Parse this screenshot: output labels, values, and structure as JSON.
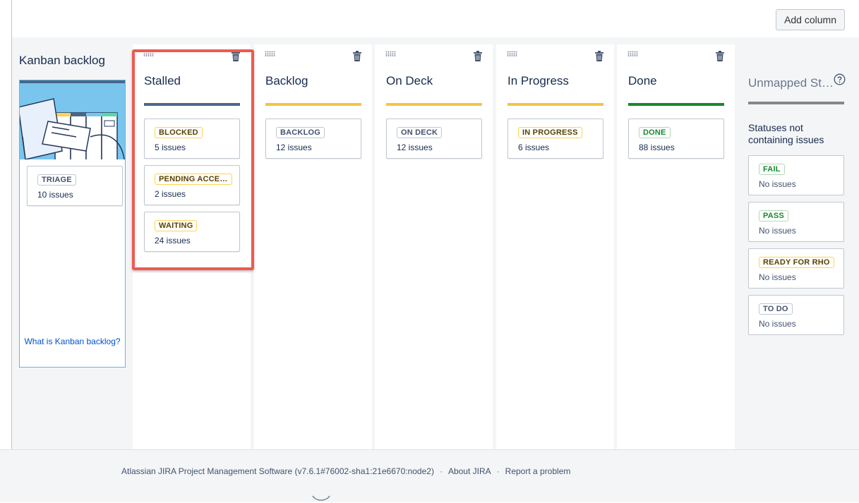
{
  "toolbar": {
    "add_column_label": "Add column"
  },
  "backlog": {
    "title": "Kanban backlog",
    "card": {
      "status": "TRIAGE",
      "count": "10 issues"
    },
    "help_link": "What is Kanban backlog?"
  },
  "columns": [
    {
      "title": "Stalled",
      "bar_color": "#4a6785",
      "cards": [
        {
          "status": "BLOCKED",
          "count": "5 issues",
          "color": "yellow"
        },
        {
          "status": "PENDING ACCE…",
          "count": "2 issues",
          "color": "yellow"
        },
        {
          "status": "WAITING",
          "count": "24 issues",
          "color": "yellow"
        }
      ]
    },
    {
      "title": "Backlog",
      "bar_color": "#f6c342",
      "cards": [
        {
          "status": "BACKLOG",
          "count": "12 issues",
          "color": "blue"
        }
      ]
    },
    {
      "title": "On Deck",
      "bar_color": "#f6c342",
      "cards": [
        {
          "status": "ON DECK",
          "count": "12 issues",
          "color": "blue"
        }
      ]
    },
    {
      "title": "In Progress",
      "bar_color": "#f6c342",
      "cards": [
        {
          "status": "IN PROGRESS",
          "count": "6 issues",
          "color": "yellow"
        }
      ]
    },
    {
      "title": "Done",
      "bar_color": "#14892c",
      "cards": [
        {
          "status": "DONE",
          "count": "88 issues",
          "color": "green"
        }
      ]
    }
  ],
  "unmapped": {
    "title": "Unmapped St…",
    "subtitle": "Statuses not containing issues",
    "cards": [
      {
        "status": "FAIL",
        "count": "No issues",
        "color": "green"
      },
      {
        "status": "PASS",
        "count": "No issues",
        "color": "green"
      },
      {
        "status": "READY FOR RHO",
        "count": "No issues",
        "color": "yellow"
      },
      {
        "status": "TO DO",
        "count": "No issues",
        "color": "blue"
      }
    ]
  },
  "footer": {
    "software": "Atlassian JIRA Project Management Software (v7.6.1#76002-sha1:21e6670:node2)",
    "about": "About JIRA",
    "report": "Report a problem"
  },
  "icons": {
    "drag": "drag-handle-icon",
    "delete": "trash-icon",
    "help": "help-icon"
  }
}
